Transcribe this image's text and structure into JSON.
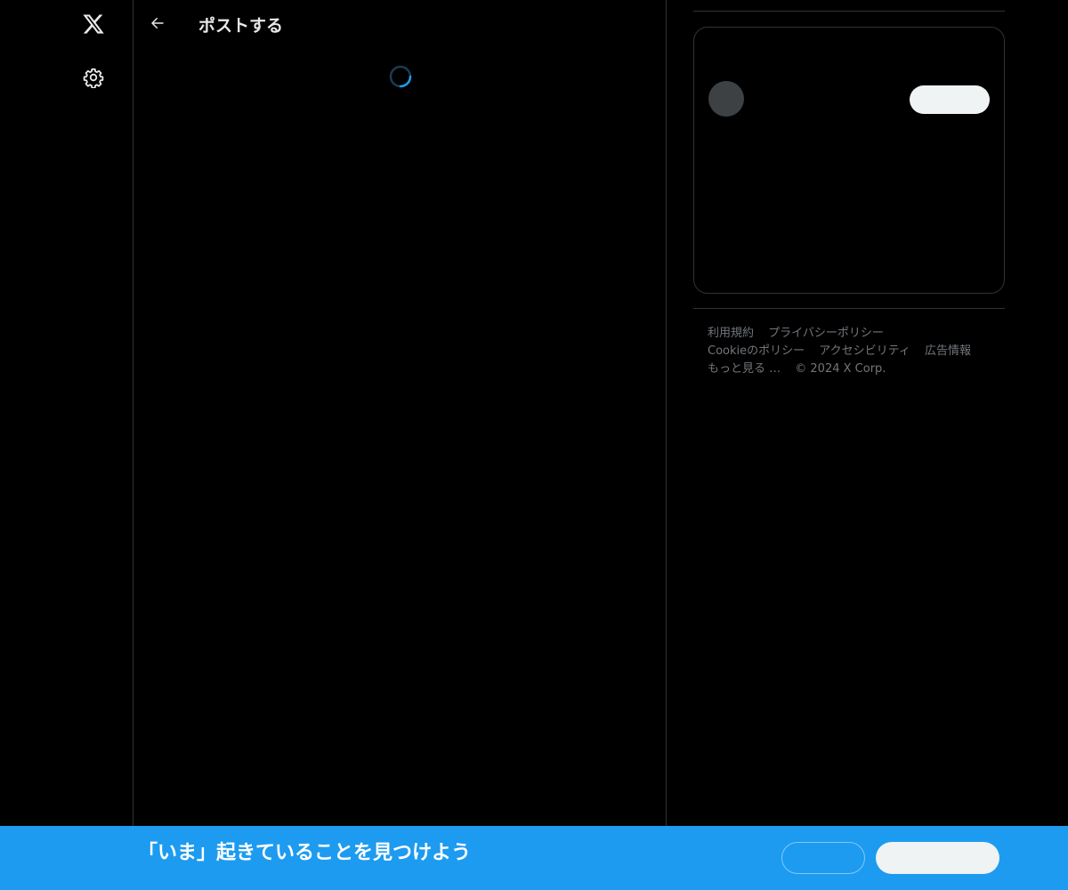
{
  "header": {
    "title": "ポストする"
  },
  "footer": {
    "links": [
      "利用規約",
      "プライバシーポリシー",
      "Cookieのポリシー",
      "アクセシビリティ",
      "広告情報",
      "もっと見る …"
    ],
    "copyright": "© 2024 X Corp."
  },
  "banner": {
    "text": "「いま」起きていることを見つけよう"
  },
  "icons": {
    "logo": "x-logo-icon",
    "settings": "gear-icon",
    "back": "arrow-left-icon",
    "loading": "loading-spinner-icon"
  },
  "colors": {
    "background": "#000000",
    "text": "#e7e9ea",
    "secondary_text": "#71767b",
    "border": "#2f3336",
    "accent": "#1d9bf0",
    "button_light": "#eff3f4",
    "avatar_placeholder": "#3e4144"
  }
}
